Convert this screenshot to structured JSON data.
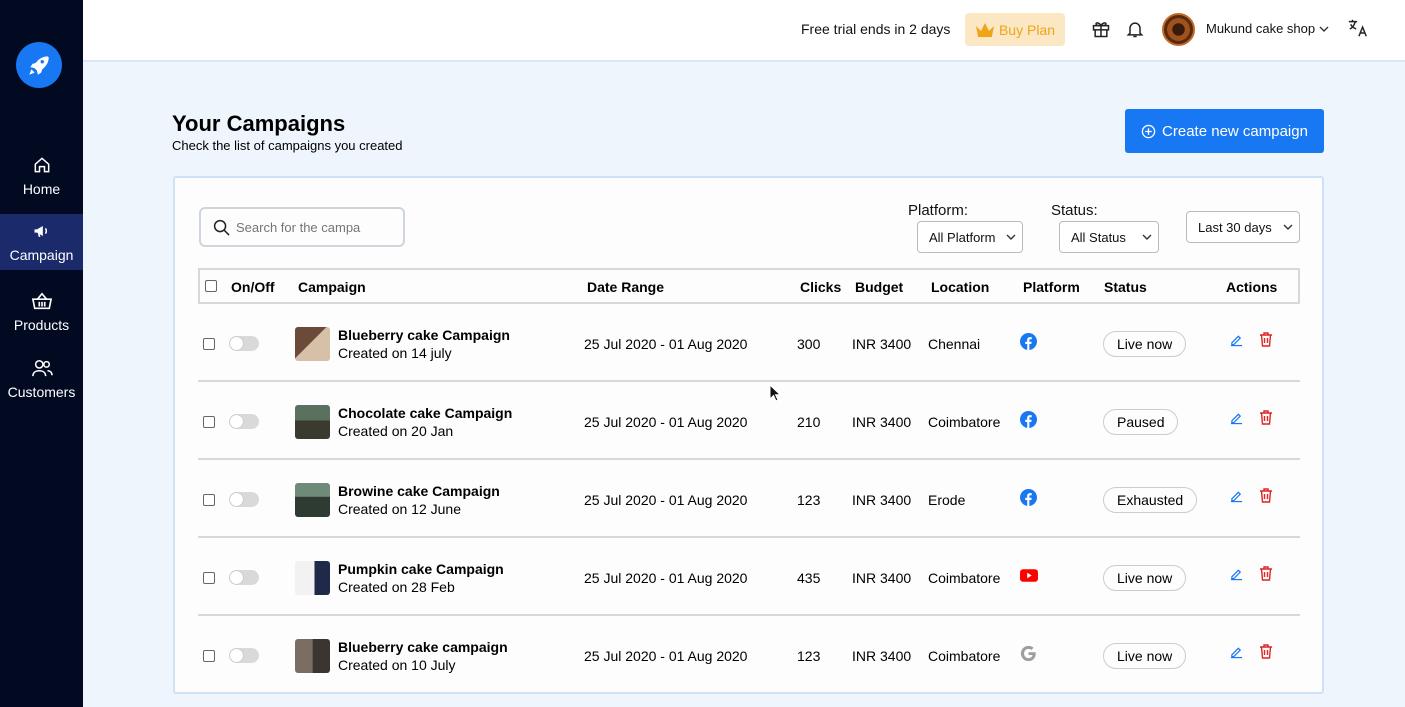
{
  "sidebar": {
    "logo": "rocket-icon",
    "items": [
      {
        "label": "Home",
        "icon": "home-icon",
        "active": false
      },
      {
        "label": "Campaign",
        "icon": "megaphone-icon",
        "active": true
      },
      {
        "label": "Products",
        "icon": "basket-icon",
        "active": false
      },
      {
        "label": "Customers",
        "icon": "users-icon",
        "active": false
      }
    ]
  },
  "topbar": {
    "trial_text": "Free trial ends in 2 days",
    "buy_label": "Buy Plan",
    "shop_name": "Mukund cake shop",
    "icons": [
      "gift-icon",
      "bell-icon",
      "translate-icon"
    ]
  },
  "page": {
    "title": "Your Campaigns",
    "subtitle": "Check the list of campaigns you created",
    "create_label": "Create new campaign"
  },
  "filters": {
    "search_placeholder": "Search for the campa",
    "platform_label": "Platform:",
    "platform_value": "All Platform",
    "status_label": "Status:",
    "status_value": "All Status",
    "range_value": "Last 30 days"
  },
  "table": {
    "headers": {
      "onoff": "On/Off",
      "campaign": "Campaign",
      "date_range": "Date Range",
      "clicks": "Clicks",
      "budget": "Budget",
      "location": "Location",
      "platform": "Platform",
      "status": "Status",
      "actions": "Actions"
    },
    "rows": [
      {
        "name": "Blueberry cake Campaign",
        "created": "Created on 14 july",
        "date_range": "25 Jul 2020 - 01 Aug 2020",
        "clicks": "300",
        "budget": "INR 3400",
        "location": "Chennai",
        "platform": "facebook-icon",
        "status": "Live now"
      },
      {
        "name": "Chocolate cake Campaign",
        "created": "Created on 20 Jan",
        "date_range": "25 Jul 2020 - 01 Aug 2020",
        "clicks": "210",
        "budget": "INR 3400",
        "location": "Coimbatore",
        "platform": "facebook-icon",
        "status": "Paused"
      },
      {
        "name": "Browine cake Campaign",
        "created": "Created on 12 June",
        "date_range": "25 Jul 2020 - 01 Aug 2020",
        "clicks": "123",
        "budget": "INR 3400",
        "location": "Erode",
        "platform": "facebook-icon",
        "status": "Exhausted"
      },
      {
        "name": "Pumpkin cake Campaign",
        "created": "Created on 28 Feb",
        "date_range": "25 Jul 2020 - 01 Aug 2020",
        "clicks": "435",
        "budget": "INR 3400",
        "location": "Coimbatore",
        "platform": "youtube-icon",
        "status": "Live now"
      },
      {
        "name": "Blueberry cake campaign",
        "created": "Created on 10 July",
        "date_range": "25 Jul 2020 - 01 Aug 2020",
        "clicks": "123",
        "budget": "INR 3400",
        "location": "Coimbatore",
        "platform": "google-icon",
        "status": "Live now"
      }
    ]
  },
  "colors": {
    "sidebar_bg": "#020a22",
    "sidebar_active": "#1a2a6a",
    "accent": "#1877f2",
    "buy_bg": "#fbe7c4",
    "buy_text": "#f0a418",
    "delete": "#e02424",
    "youtube": "#ff0000",
    "google": "#9e9e9e"
  }
}
